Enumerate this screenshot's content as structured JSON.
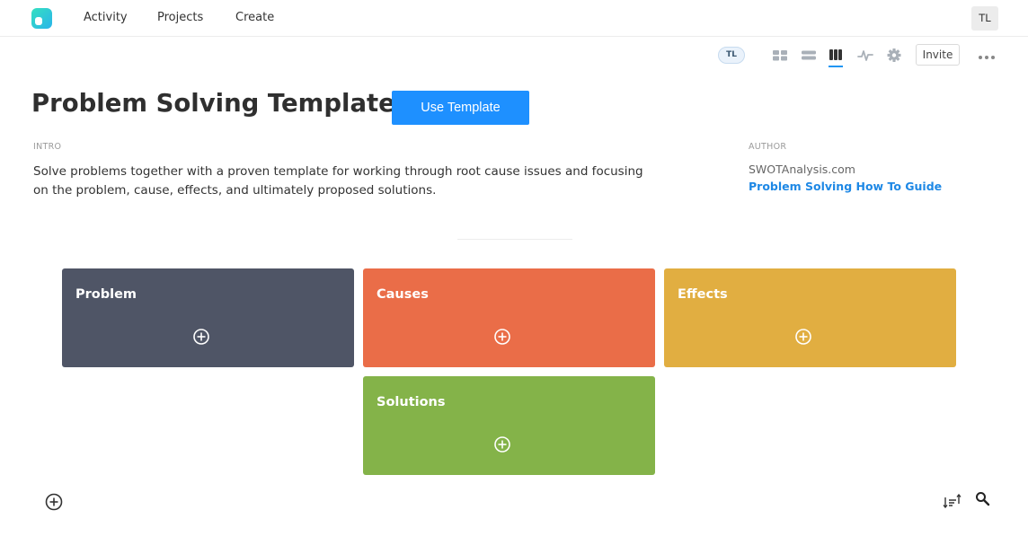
{
  "nav": {
    "items": [
      {
        "label": "Activity"
      },
      {
        "label": "Projects"
      },
      {
        "label": "Create"
      }
    ],
    "user_initials": "TL"
  },
  "toolbar": {
    "member_initials": "TL",
    "icons": [
      "grid-view-icon",
      "list-view-icon",
      "board-view-icon",
      "activity-icon",
      "settings-icon"
    ],
    "active_view": "board-view-icon",
    "invite_label": "Invite"
  },
  "header": {
    "title": "Problem Solving Template",
    "use_template_label": "Use Template"
  },
  "intro": {
    "label": "INTRO",
    "text": "Solve problems together with a proven template for working through root cause issues and focusing on the problem, cause, effects, and ultimately proposed solutions."
  },
  "author": {
    "label": "AUTHOR",
    "name": "SWOTAnalysis.com",
    "link": "Problem Solving How To Guide"
  },
  "board": {
    "columns": [
      {
        "title": "Problem",
        "color": "#4f5566"
      },
      {
        "title": "Causes",
        "color": "#ea6d48"
      },
      {
        "title": "Effects",
        "color": "#e1ae41"
      },
      {
        "title": "Solutions",
        "color": "#84b349"
      }
    ]
  },
  "colors": {
    "accent": "#1e90ff",
    "link": "#1e88e5"
  }
}
